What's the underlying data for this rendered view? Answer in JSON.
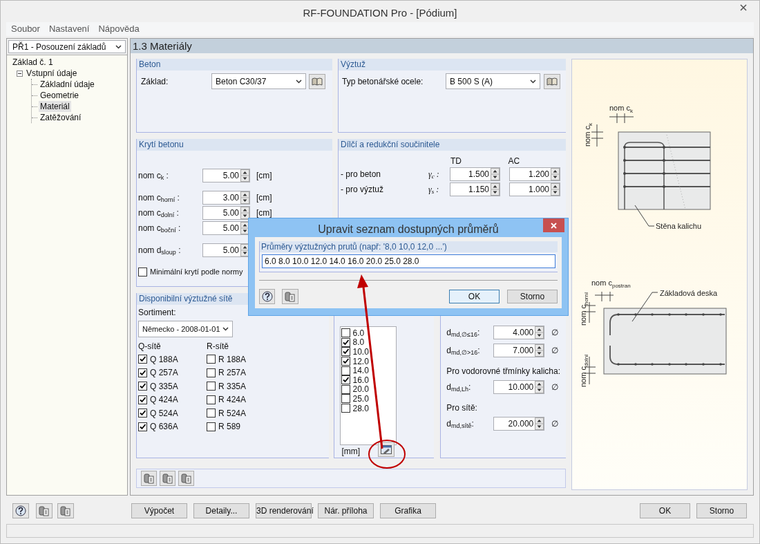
{
  "window": {
    "title": "RF-FOUNDATION Pro - [Pódium]"
  },
  "menu": [
    "Soubor",
    "Nastavení",
    "Nápověda"
  ],
  "sidebar": {
    "case_select": "PŘ1 - Posouzení základů",
    "tree": [
      {
        "label": "Základ č. 1",
        "selected": false,
        "children": [
          {
            "label": "Vstupní údaje",
            "selected": false,
            "expanded": true,
            "children": [
              {
                "label": "Základní údaje",
                "selected": false
              },
              {
                "label": "Geometrie",
                "selected": false
              },
              {
                "label": "Materiál",
                "selected": true
              },
              {
                "label": "Zatěžování",
                "selected": false
              }
            ]
          }
        ]
      }
    ]
  },
  "page_title": "1.3 Materiály",
  "beton": {
    "title": "Beton",
    "label": "Základ:",
    "value": "Beton C30/37"
  },
  "vyztuz": {
    "title": "Výztuž",
    "label": "Typ betonářské ocele:",
    "value": "B 500 S (A)"
  },
  "kryti": {
    "title": "Krytí betonu",
    "rows": [
      {
        "label": "nom c$_{k}$ :",
        "value": "5.00",
        "unit": "[cm]"
      },
      {
        "label": "nom c$_{horní}$ :",
        "value": "3.00",
        "unit": "[cm]"
      },
      {
        "label": "nom c$_{dolní}$ :",
        "value": "5.00",
        "unit": "[cm]"
      },
      {
        "label": "nom c$_{boční}$ :",
        "value": "5.00"
      },
      {
        "label": "nom d$_{sloup}$ :",
        "value": "5.00"
      }
    ],
    "checkbox": {
      "label": "Minimální krytí podle normy",
      "checked": false
    }
  },
  "soucinitele": {
    "title": "Dílčí a redukční součinitele",
    "columns": [
      "TD",
      "AC"
    ],
    "rows": [
      {
        "label": "- pro beton",
        "symbol": "γ$_{c}$ :",
        "values": [
          "1.500",
          "1.200"
        ]
      },
      {
        "label": "- pro výztuž",
        "symbol": "γ$_{s}$ :",
        "values": [
          "1.150",
          "1.000"
        ]
      }
    ]
  },
  "site": {
    "title": "Disponibilní výztužné sítě",
    "sortiment_label": "Sortiment:",
    "sortiment": "Německo - 2008-01-01",
    "q_title": "Q-sítě",
    "r_title": "R-sítě",
    "q": [
      {
        "label": "Q 188A",
        "checked": true
      },
      {
        "label": "Q 257A",
        "checked": true
      },
      {
        "label": "Q 335A",
        "checked": true
      },
      {
        "label": "Q 424A",
        "checked": true
      },
      {
        "label": "Q 524A",
        "checked": true
      },
      {
        "label": "Q 636A",
        "checked": true
      }
    ],
    "r": [
      {
        "label": "R 188A",
        "checked": false
      },
      {
        "label": "R 257A",
        "checked": false
      },
      {
        "label": "R 335A",
        "checked": false
      },
      {
        "label": "R 424A",
        "checked": false
      },
      {
        "label": "R 524A",
        "checked": false
      },
      {
        "label": "R 589",
        "checked": false
      }
    ]
  },
  "diameters": {
    "unit": "[mm]",
    "items": [
      {
        "label": "6.0",
        "checked": false
      },
      {
        "label": "8.0",
        "checked": true
      },
      {
        "label": "10.0",
        "checked": true
      },
      {
        "label": "12.0",
        "checked": true
      },
      {
        "label": "14.0",
        "checked": false
      },
      {
        "label": "16.0",
        "checked": true
      },
      {
        "label": "20.0",
        "checked": false
      },
      {
        "label": "25.0",
        "checked": false
      },
      {
        "label": "28.0",
        "checked": false
      }
    ]
  },
  "pruty": [
    {
      "kind": "field",
      "label": "d$_{md,∅≤16}$:",
      "value": "4.000",
      "sign": "∅"
    },
    {
      "kind": "field",
      "label": "d$_{md,∅>16}$:",
      "value": "7.000",
      "sign": "∅"
    },
    {
      "kind": "heading",
      "label": "Pro vodorovné třmínky kalicha:"
    },
    {
      "kind": "field",
      "label": "d$_{md,Lh}$:",
      "value": "10.000",
      "sign": "∅"
    },
    {
      "kind": "heading",
      "label": "Pro sítě:"
    },
    {
      "kind": "field",
      "label": "d$_{md,sítě}$:",
      "value": "20.000",
      "sign": "∅"
    }
  ],
  "drawing": {
    "wall_cover_top": {
      "text": "nom c",
      "sub": "k"
    },
    "wall_cover_side": {
      "text": "nom c",
      "sub": "k"
    },
    "wall_label": "Stěna kalichu",
    "slab_cover_side": {
      "text": "nom c",
      "sub": "postran"
    },
    "slab_label": "Základová deska",
    "slab_cover_top": {
      "text": "nom c",
      "sub": "horní"
    },
    "slab_cover_bottom": {
      "text": "nom c",
      "sub": "dolní"
    }
  },
  "footer": {
    "buttons": [
      "Výpočet",
      "Detaily...",
      "3D renderování",
      "Nár. příloha",
      "Grafika"
    ],
    "ok": "OK",
    "cancel": "Storno"
  },
  "dialog": {
    "title": "Upravit seznam dostupných průměrů",
    "group_title": "Průměry výztužných prutů (např: '8,0 10,0 12,0 ...')",
    "value": "6.0 8.0 10.0 12.0 14.0 16.0 20.0 25.0 28.0",
    "buttons": [
      {
        "label": "OK",
        "default": true
      },
      {
        "label": "Storno",
        "default": false
      }
    ]
  }
}
